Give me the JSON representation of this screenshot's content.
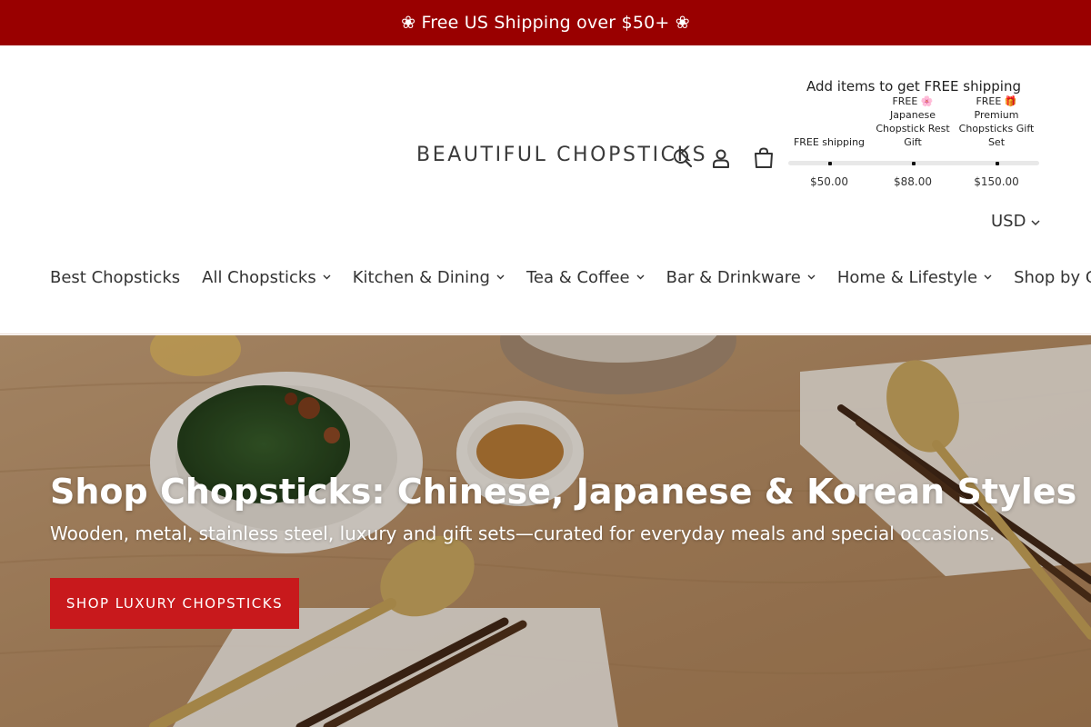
{
  "announcement": {
    "text": "❀ Free US Shipping over $50+ ❀"
  },
  "header": {
    "logo_text": "BEAUTIFUL CHOPSTICKS",
    "icons": [
      "search-icon",
      "account-icon",
      "cart-icon"
    ],
    "currency": "USD"
  },
  "shipping_progress": {
    "title": "Add items to get FREE shipping",
    "progress": 0,
    "milestones": [
      {
        "label": "FREE shipping",
        "price": "$50.00"
      },
      {
        "label": "FREE 🌸 Japanese Chopstick Rest Gift",
        "price": "$88.00"
      },
      {
        "label": "FREE 🎁 Premium Chopsticks Gift Set",
        "price": "$150.00"
      }
    ]
  },
  "nav": {
    "items": [
      {
        "label": "Best Chopsticks"
      },
      {
        "label": "All Chopsticks"
      },
      {
        "label": "Kitchen & Dining"
      },
      {
        "label": "Tea & Coffee"
      },
      {
        "label": "Bar & Drinkware"
      },
      {
        "label": "Home & Lifestyle"
      },
      {
        "label": "Shop by Gifts"
      }
    ]
  },
  "hero": {
    "title": "Shop Chopsticks: Chinese, Japanese & Korean Styles",
    "subtitle": "Wooden, metal, stainless steel, luxury and gift sets—curated for everyday meals and special occasions.",
    "cta_label": "SHOP LUXURY CHOPSTICKS"
  },
  "colors": {
    "announcement_bg": "#990000",
    "cta_bg": "#c8191c",
    "text_dark": "#333333",
    "hero_wood": "#b99470"
  }
}
